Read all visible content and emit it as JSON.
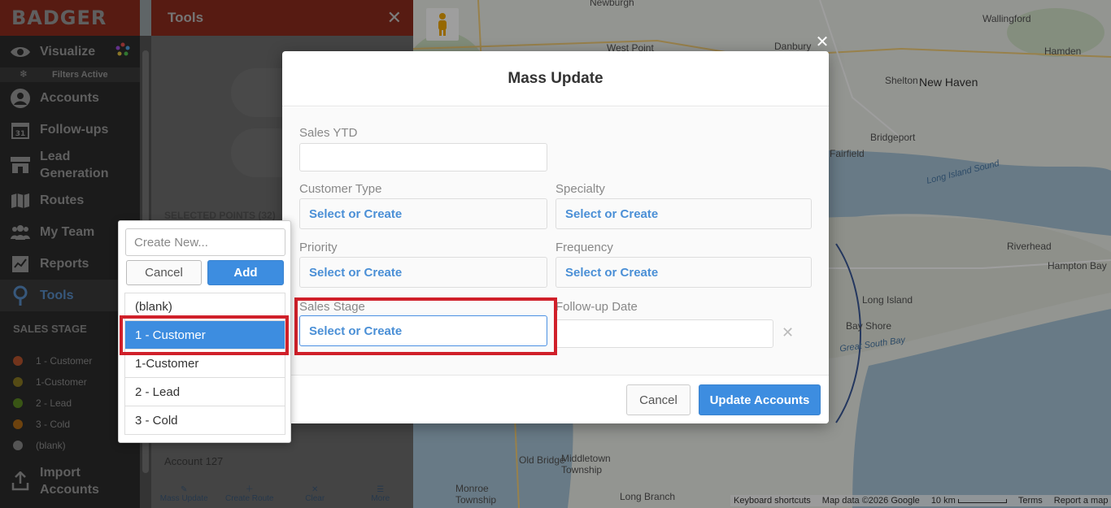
{
  "app": {
    "brand": "BADGER",
    "nav": [
      {
        "label": "Visualize",
        "icon": "eye-icon"
      },
      {
        "label": "Accounts",
        "icon": "person-icon"
      },
      {
        "label": "Follow-ups",
        "icon": "calendar-icon"
      },
      {
        "label": "Lead Generation",
        "icon": "storefront-icon"
      },
      {
        "label": "Routes",
        "icon": "map-icon"
      },
      {
        "label": "My Team",
        "icon": "team-icon"
      },
      {
        "label": "Reports",
        "icon": "chart-icon"
      },
      {
        "label": "Tools",
        "icon": "pin-icon"
      },
      {
        "label": "Import Accounts",
        "icon": "upload-icon"
      }
    ],
    "filters_active": "Filters Active",
    "sales_stage_title": "SALES STAGE",
    "legend": [
      {
        "label": "1 - Customer",
        "color": "#b8552e"
      },
      {
        "label": "1-Customer",
        "color": "#8a7a22"
      },
      {
        "label": "2 - Lead",
        "color": "#5d8a22"
      },
      {
        "label": "3 - Cold",
        "color": "#b06b18"
      },
      {
        "label": "(blank)",
        "color": "#8a8a8a"
      }
    ]
  },
  "tools_panel": {
    "title": "Tools",
    "selected_points": "SELECTED POINTS (32)",
    "account_row": "Account 127",
    "bottom_tools": [
      {
        "label": "Mass Update",
        "icon": "user-edit-icon"
      },
      {
        "label": "Create Route",
        "icon": "map-plus-icon"
      },
      {
        "label": "Clear",
        "icon": "x-icon"
      },
      {
        "label": "More",
        "icon": "menu-icon"
      }
    ]
  },
  "map": {
    "labels": {
      "newburgh": "Newburgh",
      "wallingford": "Wallingford",
      "west_point": "West Point",
      "danbury": "Danbury",
      "hamden": "Hamden",
      "shelton": "Shelton",
      "new_haven": "New Haven",
      "bridgeport": "Bridgeport",
      "fairfield": "Fairfield",
      "long_island_sound": "Long Island Sound",
      "riverhead": "Riverhead",
      "hampton_bay": "Hampton Bay",
      "long_island": "Long Island",
      "bay_shore": "Bay Shore",
      "great_south_bay": "Great South Bay",
      "old_bridge": "Old Bridge",
      "middletown": "Middletown Township",
      "monroe": "Monroe Township",
      "long_branch": "Long Branch"
    },
    "footer": {
      "shortcuts": "Keyboard shortcuts",
      "data": "Map data ©2026 Google",
      "scale": "10 km",
      "terms": "Terms",
      "report": "Report a map error"
    }
  },
  "modal": {
    "title": "Mass Update",
    "fields": {
      "sales_ytd": {
        "label": "Sales YTD",
        "value": ""
      },
      "customer_type": {
        "label": "Customer Type",
        "value": "Select or Create"
      },
      "specialty": {
        "label": "Specialty",
        "value": "Select or Create"
      },
      "priority": {
        "label": "Priority",
        "value": "Select or Create"
      },
      "frequency": {
        "label": "Frequency",
        "value": "Select or Create"
      },
      "sales_stage": {
        "label": "Sales Stage",
        "value": "Select or Create"
      },
      "follow_up_date": {
        "label": "Follow-up Date",
        "value": ""
      }
    },
    "cancel_label": "Cancel",
    "submit_label": "Update Accounts"
  },
  "dropdown": {
    "placeholder": "Create New...",
    "cancel_label": "Cancel",
    "add_label": "Add",
    "options": [
      "(blank)",
      "1 - Customer",
      "1-Customer",
      "2 - Lead",
      "3 - Cold"
    ],
    "selected": "1 - Customer"
  }
}
